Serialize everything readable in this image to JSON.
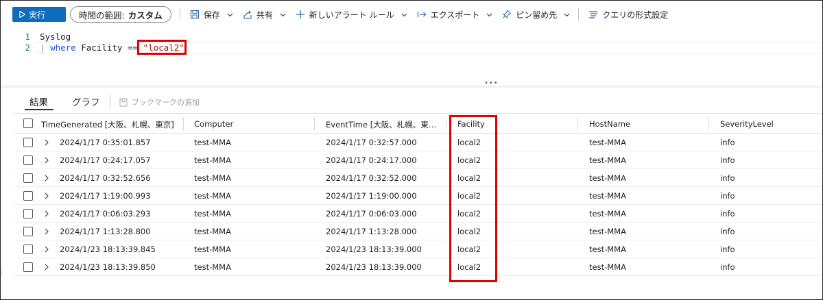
{
  "toolbar": {
    "run_label": "実行",
    "time_range_label": "時間の範囲:",
    "time_range_value": "カスタム",
    "save_label": "保存",
    "share_label": "共有",
    "new_alert_label": "新しいアラート ルール",
    "export_label": "エクスポート",
    "pin_label": "ピン留め先",
    "format_label": "クエリの形式設定"
  },
  "editor": {
    "line_numbers": [
      "1",
      "2"
    ],
    "line1": "Syslog",
    "line2_pipe": "| ",
    "line2_keyword": "where",
    "line2_mid": " Facility == ",
    "line2_string": "\"local2\""
  },
  "tabs": {
    "results": "結果",
    "chart": "グラフ",
    "bookmark": "ブックマークの追加"
  },
  "table": {
    "columns": [
      "TimeGenerated [大阪、札幌、東京]",
      "Computer",
      "EventTime [大阪、札幌、東…",
      "Facility",
      "HostName",
      "SeverityLevel"
    ],
    "rows": [
      [
        "2024/1/17 0:35:01.857",
        "test-MMA",
        "2024/1/17 0:32:57.000",
        "local2",
        "test-MMA",
        "info"
      ],
      [
        "2024/1/17 0:24:17.057",
        "test-MMA",
        "2024/1/17 0:24:17.000",
        "local2",
        "test-MMA",
        "info"
      ],
      [
        "2024/1/17 0:32:52.656",
        "test-MMA",
        "2024/1/17 0:32:52.000",
        "local2",
        "test-MMA",
        "info"
      ],
      [
        "2024/1/17 1:19:00.993",
        "test-MMA",
        "2024/1/17 1:19:00.000",
        "local2",
        "test-MMA",
        "info"
      ],
      [
        "2024/1/17 0:06:03.293",
        "test-MMA",
        "2024/1/17 0:06:03.000",
        "local2",
        "test-MMA",
        "info"
      ],
      [
        "2024/1/17 1:13:28.800",
        "test-MMA",
        "2024/1/17 1:13:28.000",
        "local2",
        "test-MMA",
        "info"
      ],
      [
        "2024/1/23 18:13:39.845",
        "test-MMA",
        "2024/1/23 18:13:39.000",
        "local2",
        "test-MMA",
        "info"
      ],
      [
        "2024/1/23 18:13:39.850",
        "test-MMA",
        "2024/1/23 18:13:39.000",
        "local2",
        "test-MMA",
        "info"
      ]
    ]
  },
  "colors": {
    "accent": "#0f6cbd",
    "highlight_box": "#e00000",
    "keyword": "#1e4fe0",
    "string": "#a31515"
  }
}
